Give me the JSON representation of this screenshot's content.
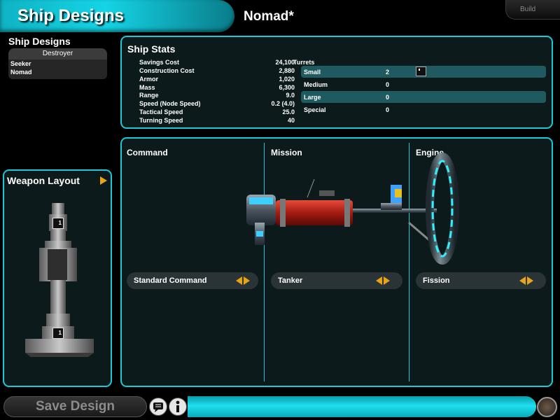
{
  "header": {
    "title": "Ship Designs",
    "design_name": "Nomad*",
    "build_tab": "Build"
  },
  "designs": {
    "title": "Ship Designs",
    "class_name": "Destroyer",
    "items": [
      "Seeker",
      "Nomad"
    ]
  },
  "stats": {
    "title": "Ship Stats",
    "rows": [
      {
        "label": "Savings Cost",
        "value": "24,100"
      },
      {
        "label": "Construction Cost",
        "value": "2,880"
      },
      {
        "label": "Armor",
        "value": "1,020"
      },
      {
        "label": "Mass",
        "value": "6,300"
      },
      {
        "label": "Range",
        "value": "9.0"
      },
      {
        "label": "Speed (Node Speed)",
        "value": "0.2 (4.0)"
      },
      {
        "label": "Tactical Speed",
        "value": "25.0"
      },
      {
        "label": "Turning Speed",
        "value": "40"
      }
    ],
    "turrets_label": "Turrets",
    "turrets": [
      {
        "label": "Small",
        "value": "2"
      },
      {
        "label": "Medium",
        "value": "0"
      },
      {
        "label": "Large",
        "value": "0"
      },
      {
        "label": "Special",
        "value": "0"
      }
    ]
  },
  "weapon_layout": {
    "title": "Weapon Layout",
    "slot_marks": [
      "1",
      "1"
    ]
  },
  "modules": {
    "columns": [
      {
        "title": "Command",
        "selection": "Standard Command"
      },
      {
        "title": "Mission",
        "selection": "Tanker"
      },
      {
        "title": "Engine",
        "selection": "Fission"
      }
    ]
  },
  "footer": {
    "save_label": "Save Design"
  },
  "colors": {
    "accent": "#1bc8d8",
    "arrow": "#e8a317"
  }
}
